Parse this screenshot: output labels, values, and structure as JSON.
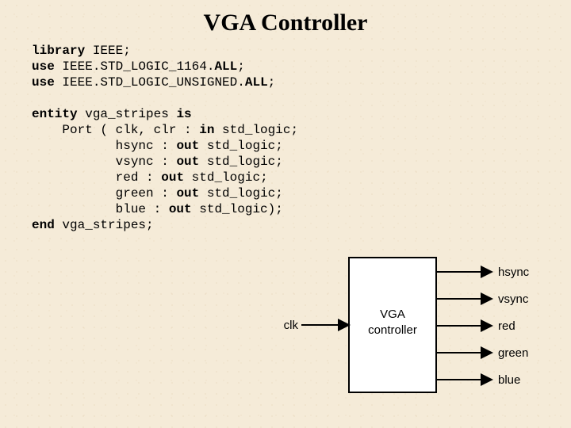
{
  "title": "VGA Controller",
  "code": {
    "l1a": "library",
    "l1b": " IEEE;",
    "l2a": "use",
    "l2b": " IEEE.STD_LOGIC_1164.",
    "l2c": "ALL",
    "l2d": ";",
    "l3a": "use",
    "l3b": " IEEE.STD_LOGIC_UNSIGNED.",
    "l3c": "ALL",
    "l3d": ";",
    "l4": "",
    "l5a": "entity",
    "l5b": " vga_stripes ",
    "l5c": "is",
    "l6a": "    Port ( clk, clr : ",
    "l6b": "in",
    "l6c": " std_logic;",
    "l7a": "           hsync : ",
    "l7b": "out",
    "l7c": " std_logic;",
    "l8a": "           vsync : ",
    "l8b": "out",
    "l8c": " std_logic;",
    "l9a": "           red : ",
    "l9b": "out",
    "l9c": " std_logic;",
    "l10a": "           green : ",
    "l10b": "out",
    "l10c": " std_logic;",
    "l11a": "           blue : ",
    "l11b": "out",
    "l11c": " std_logic);",
    "l12a": "end",
    "l12b": " vga_stripes;"
  },
  "diagram": {
    "block_l1": "VGA",
    "block_l2": "controller",
    "in": "clk",
    "out1": "hsync",
    "out2": "vsync",
    "out3": "red",
    "out4": "green",
    "out5": "blue"
  }
}
